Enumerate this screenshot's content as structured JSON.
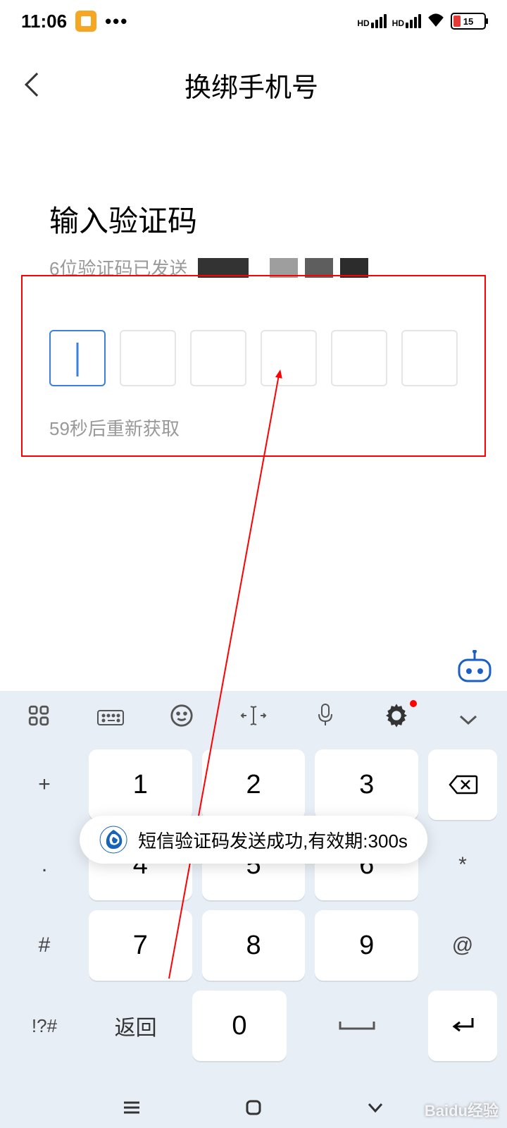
{
  "status": {
    "time": "11:06",
    "dots": "•••",
    "hd1": "HD",
    "hd2": "HD",
    "battery": "15"
  },
  "nav": {
    "title": "换绑手机号"
  },
  "content": {
    "title": "输入验证码",
    "hint": "6位验证码已发送",
    "resend": "59秒后重新获取"
  },
  "keyboard": {
    "row1": {
      "side": "+",
      "k1": "1",
      "k2": "2",
      "k3": "3"
    },
    "row2": {
      "side": ".",
      "k1": "4",
      "k2": "5",
      "k3": "6",
      "end": "*"
    },
    "row3": {
      "side": "#",
      "k1": "7",
      "k2": "8",
      "k3": "9",
      "end": "@"
    },
    "row4": {
      "sym": "!?#",
      "ret": "返回",
      "zero": "0"
    }
  },
  "toast": {
    "text": "短信验证码发送成功,有效期:300s"
  },
  "watermark": "Baidu经验"
}
